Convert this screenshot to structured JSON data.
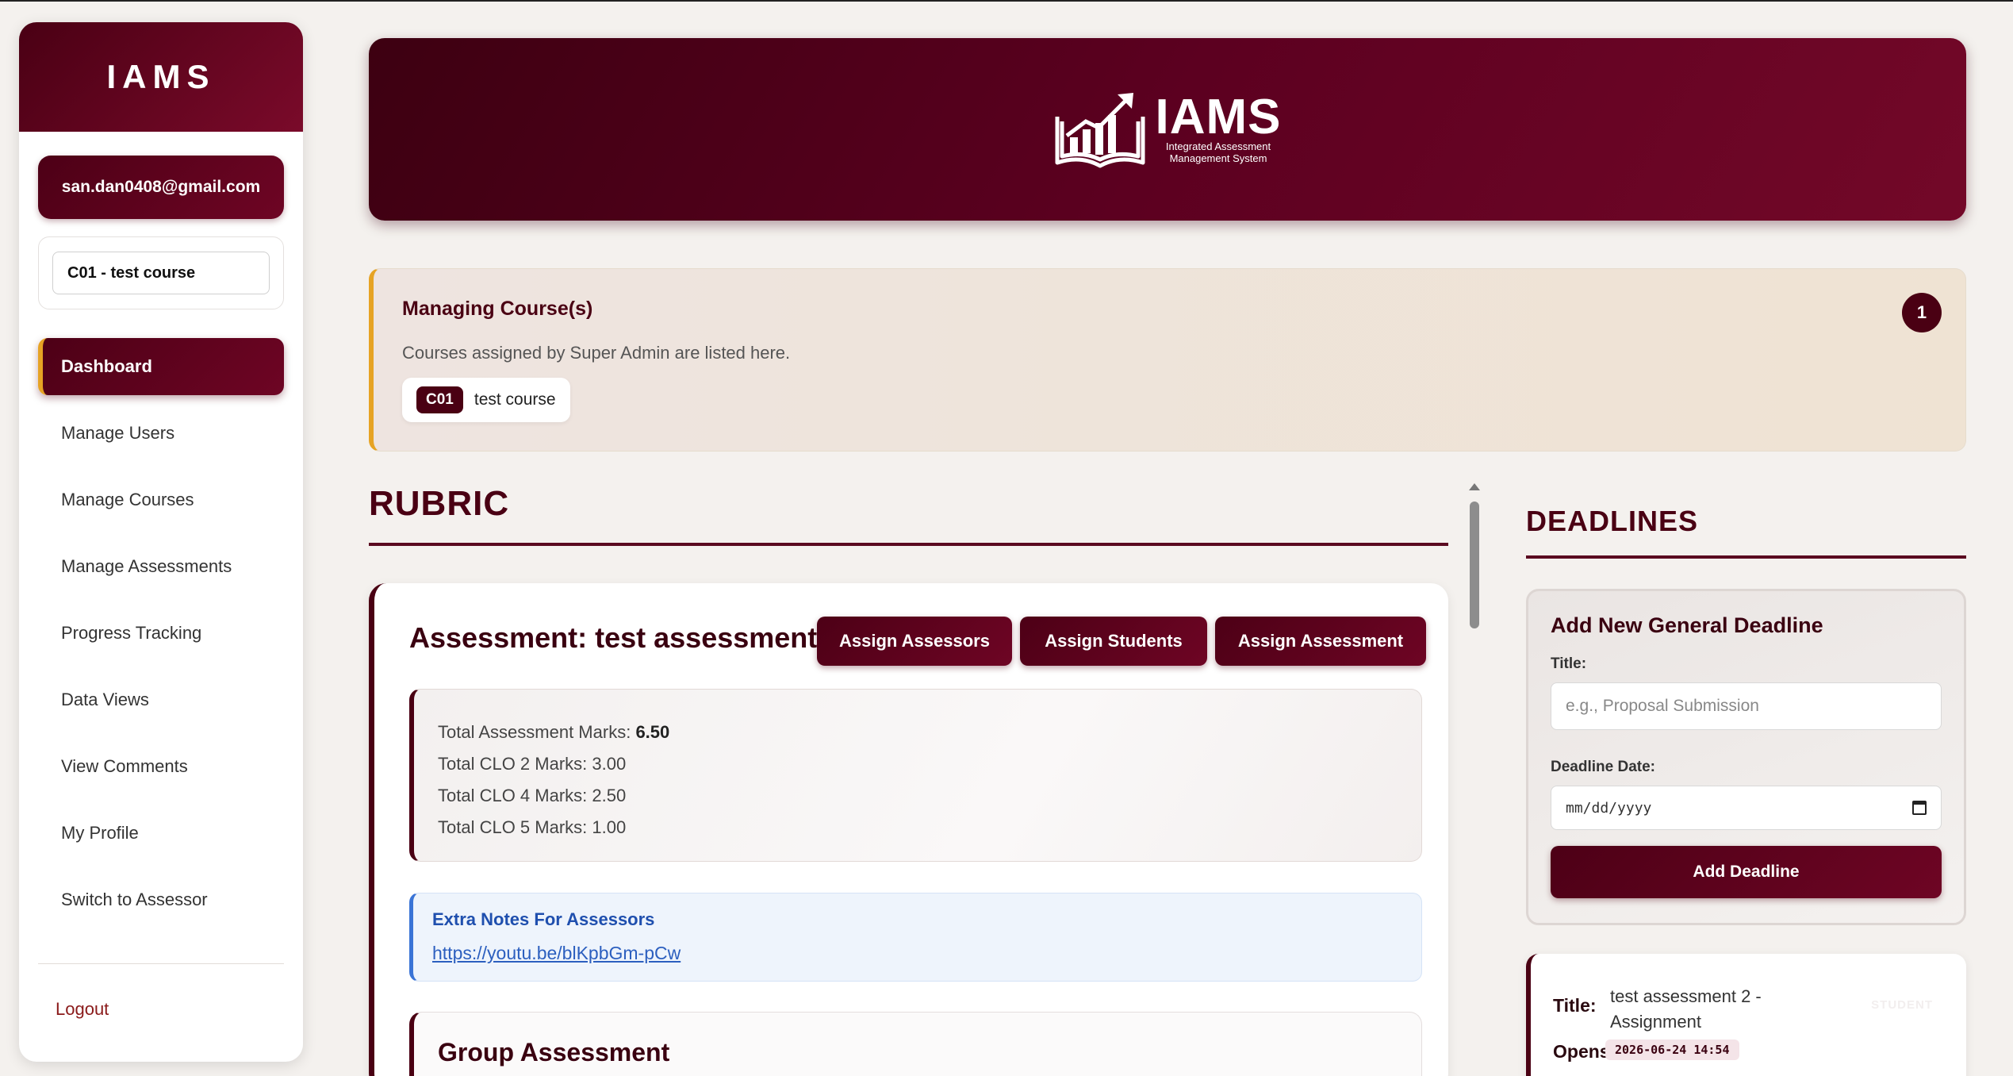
{
  "sidebar": {
    "brand": "IAMS",
    "user_email": "san.dan0408@gmail.com",
    "course_select": "C01 - test course",
    "nav": [
      {
        "label": "Dashboard",
        "active": true
      },
      {
        "label": "Manage Users"
      },
      {
        "label": "Manage Courses"
      },
      {
        "label": "Manage Assessments"
      },
      {
        "label": "Progress Tracking"
      },
      {
        "label": "Data Views"
      },
      {
        "label": "View Comments"
      },
      {
        "label": "My Profile"
      },
      {
        "label": "Switch to Assessor"
      }
    ],
    "logout": "Logout"
  },
  "header": {
    "logo_title": "IAMS",
    "logo_sub_1": "Integrated Assessment",
    "logo_sub_2": "Management System",
    "logo_icon": "book-chart-icon"
  },
  "managing": {
    "title": "Managing Course(s)",
    "description": "Courses assigned by Super Admin are listed here.",
    "count": "1",
    "course_code": "C01",
    "course_name": "test course"
  },
  "rubric": {
    "heading": "RUBRIC",
    "assessment_title": "Assessment: test assessment",
    "buttons": {
      "assign_assessors": "Assign Assessors",
      "assign_students": "Assign Students",
      "assign_assessment": "Assign Assessment"
    },
    "marks": {
      "total_label": "Total Assessment Marks:",
      "total_value": "6.50",
      "clo2": "Total CLO 2 Marks: 3.00",
      "clo4": "Total CLO 4 Marks: 2.50",
      "clo5": "Total CLO 5 Marks: 1.00"
    },
    "notes": {
      "title": "Extra Notes For Assessors",
      "link": "https://youtu.be/blKpbGm-pCw"
    },
    "group_title": "Group Assessment"
  },
  "deadlines": {
    "heading": "DEADLINES",
    "form": {
      "title": "Add New General Deadline",
      "title_label": "Title:",
      "title_placeholder": "e.g., Proposal Submission",
      "date_label": "Deadline Date:",
      "date_placeholder": "mm/dd/yyyy",
      "button": "Add Deadline"
    },
    "card": {
      "title_label": "Title:",
      "title_value": "test assessment 2 - Assignment",
      "tag": "STUDENT",
      "opens_label": "Opens:",
      "opens_value": "2026-06-24 14:54"
    }
  },
  "colors": {
    "primary": "#4a0013",
    "accent": "#e6a324",
    "link": "#2c5fbf"
  }
}
